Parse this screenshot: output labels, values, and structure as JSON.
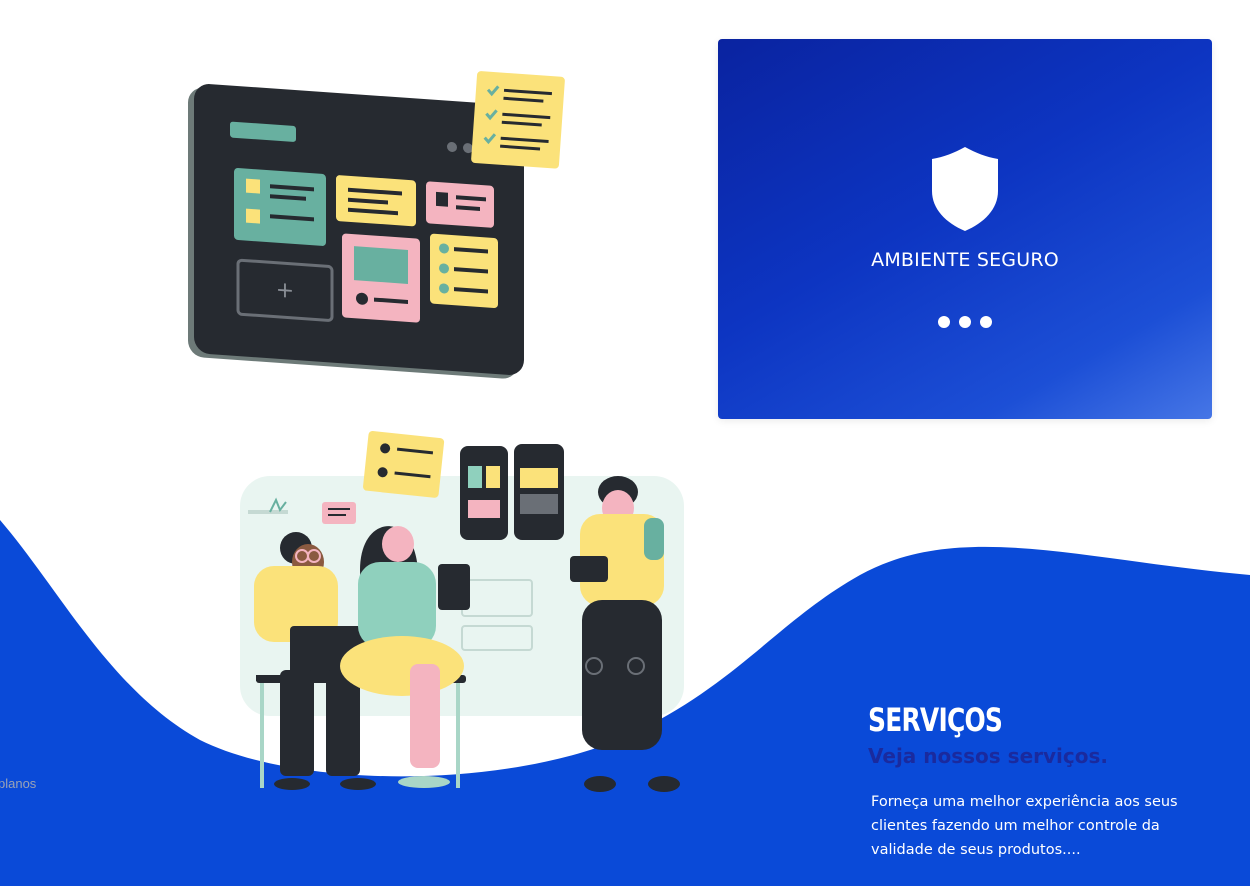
{
  "security_card": {
    "title": "AMBIENTE SEGURO",
    "icon": "shield-icon",
    "indicator_icon": "loading-dots-icon"
  },
  "services": {
    "title": "SERVIÇOS",
    "subtitle": "Veja nossos serviços.",
    "description": "Forneça uma melhor experiência aos seus clientes fazendo um melhor controle da validade de seus produtos...."
  },
  "left_fragment": "planos",
  "colors": {
    "brand_blue": "#0a4ad8",
    "card_dark": "#0a23a0",
    "subtitle": "#1a2a9e",
    "white": "#ffffff"
  }
}
